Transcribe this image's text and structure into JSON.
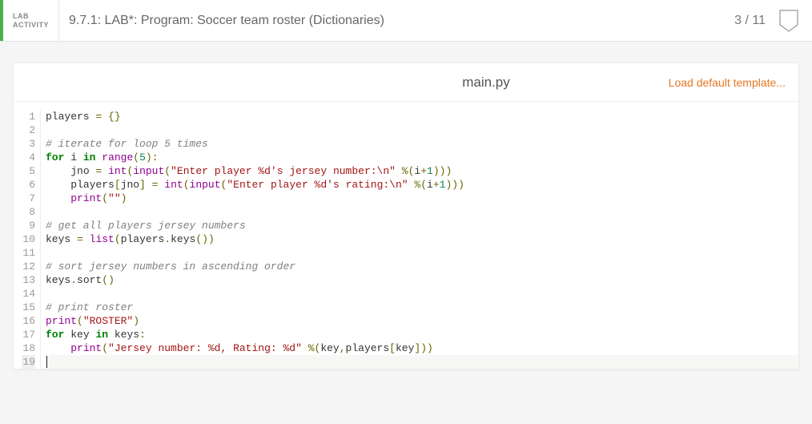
{
  "header": {
    "activity_label": "LAB\nACTIVITY",
    "title": "9.7.1: LAB*: Program: Soccer team roster (Dictionaries)",
    "score": "3 / 11"
  },
  "editor": {
    "filename": "main.py",
    "load_default_label": "Load default template...",
    "lines": [
      [
        [
          "id",
          "players"
        ],
        [
          "plain",
          " "
        ],
        [
          "op",
          "="
        ],
        [
          "plain",
          " "
        ],
        [
          "op",
          "{"
        ],
        [
          "op",
          "}"
        ]
      ],
      [
        [
          "plain",
          ""
        ]
      ],
      [
        [
          "comment",
          "# iterate for loop 5 times"
        ]
      ],
      [
        [
          "kw",
          "for"
        ],
        [
          "plain",
          " "
        ],
        [
          "id",
          "i"
        ],
        [
          "plain",
          " "
        ],
        [
          "kw",
          "in"
        ],
        [
          "plain",
          " "
        ],
        [
          "builtin",
          "range"
        ],
        [
          "op",
          "("
        ],
        [
          "num",
          "5"
        ],
        [
          "op",
          ")"
        ],
        [
          "op",
          ":"
        ]
      ],
      [
        [
          "plain",
          "    "
        ],
        [
          "id",
          "jno"
        ],
        [
          "plain",
          " "
        ],
        [
          "op",
          "="
        ],
        [
          "plain",
          " "
        ],
        [
          "builtin",
          "int"
        ],
        [
          "op",
          "("
        ],
        [
          "builtin",
          "input"
        ],
        [
          "op",
          "("
        ],
        [
          "str",
          "\"Enter player %d's jersey number:\\n\""
        ],
        [
          "plain",
          " "
        ],
        [
          "op",
          "%"
        ],
        [
          "op",
          "("
        ],
        [
          "id",
          "i"
        ],
        [
          "op",
          "+"
        ],
        [
          "num",
          "1"
        ],
        [
          "op",
          ")"
        ],
        [
          "op",
          ")"
        ],
        [
          "op",
          ")"
        ]
      ],
      [
        [
          "plain",
          "    "
        ],
        [
          "id",
          "players"
        ],
        [
          "op",
          "["
        ],
        [
          "id",
          "jno"
        ],
        [
          "op",
          "]"
        ],
        [
          "plain",
          " "
        ],
        [
          "op",
          "="
        ],
        [
          "plain",
          " "
        ],
        [
          "builtin",
          "int"
        ],
        [
          "op",
          "("
        ],
        [
          "builtin",
          "input"
        ],
        [
          "op",
          "("
        ],
        [
          "str",
          "\"Enter player %d's rating:\\n\""
        ],
        [
          "plain",
          " "
        ],
        [
          "op",
          "%"
        ],
        [
          "op",
          "("
        ],
        [
          "id",
          "i"
        ],
        [
          "op",
          "+"
        ],
        [
          "num",
          "1"
        ],
        [
          "op",
          ")"
        ],
        [
          "op",
          ")"
        ],
        [
          "op",
          ")"
        ]
      ],
      [
        [
          "plain",
          "    "
        ],
        [
          "builtin",
          "print"
        ],
        [
          "op",
          "("
        ],
        [
          "str",
          "\"\""
        ],
        [
          "op",
          ")"
        ]
      ],
      [
        [
          "plain",
          ""
        ]
      ],
      [
        [
          "comment",
          "# get all players jersey numbers"
        ]
      ],
      [
        [
          "id",
          "keys"
        ],
        [
          "plain",
          " "
        ],
        [
          "op",
          "="
        ],
        [
          "plain",
          " "
        ],
        [
          "builtin",
          "list"
        ],
        [
          "op",
          "("
        ],
        [
          "id",
          "players"
        ],
        [
          "op",
          "."
        ],
        [
          "id",
          "keys"
        ],
        [
          "op",
          "("
        ],
        [
          "op",
          ")"
        ],
        [
          "op",
          ")"
        ]
      ],
      [
        [
          "plain",
          ""
        ]
      ],
      [
        [
          "comment",
          "# sort jersey numbers in ascending order"
        ]
      ],
      [
        [
          "id",
          "keys"
        ],
        [
          "op",
          "."
        ],
        [
          "id",
          "sort"
        ],
        [
          "op",
          "("
        ],
        [
          "op",
          ")"
        ]
      ],
      [
        [
          "plain",
          ""
        ]
      ],
      [
        [
          "comment",
          "# print roster"
        ]
      ],
      [
        [
          "builtin",
          "print"
        ],
        [
          "op",
          "("
        ],
        [
          "str",
          "\"ROSTER\""
        ],
        [
          "op",
          ")"
        ]
      ],
      [
        [
          "kw",
          "for"
        ],
        [
          "plain",
          " "
        ],
        [
          "id",
          "key"
        ],
        [
          "plain",
          " "
        ],
        [
          "kw",
          "in"
        ],
        [
          "plain",
          " "
        ],
        [
          "id",
          "keys"
        ],
        [
          "op",
          ":"
        ]
      ],
      [
        [
          "plain",
          "    "
        ],
        [
          "builtin",
          "print"
        ],
        [
          "op",
          "("
        ],
        [
          "str",
          "\"Jersey number: %d, Rating: %d\""
        ],
        [
          "plain",
          " "
        ],
        [
          "op",
          "%"
        ],
        [
          "op",
          "("
        ],
        [
          "id",
          "key"
        ],
        [
          "op",
          ","
        ],
        [
          "id",
          "players"
        ],
        [
          "op",
          "["
        ],
        [
          "id",
          "key"
        ],
        [
          "op",
          "]"
        ],
        [
          "op",
          ")"
        ],
        [
          "op",
          ")"
        ]
      ],
      [
        [
          "plain",
          ""
        ]
      ]
    ],
    "cursor_line": 19
  }
}
